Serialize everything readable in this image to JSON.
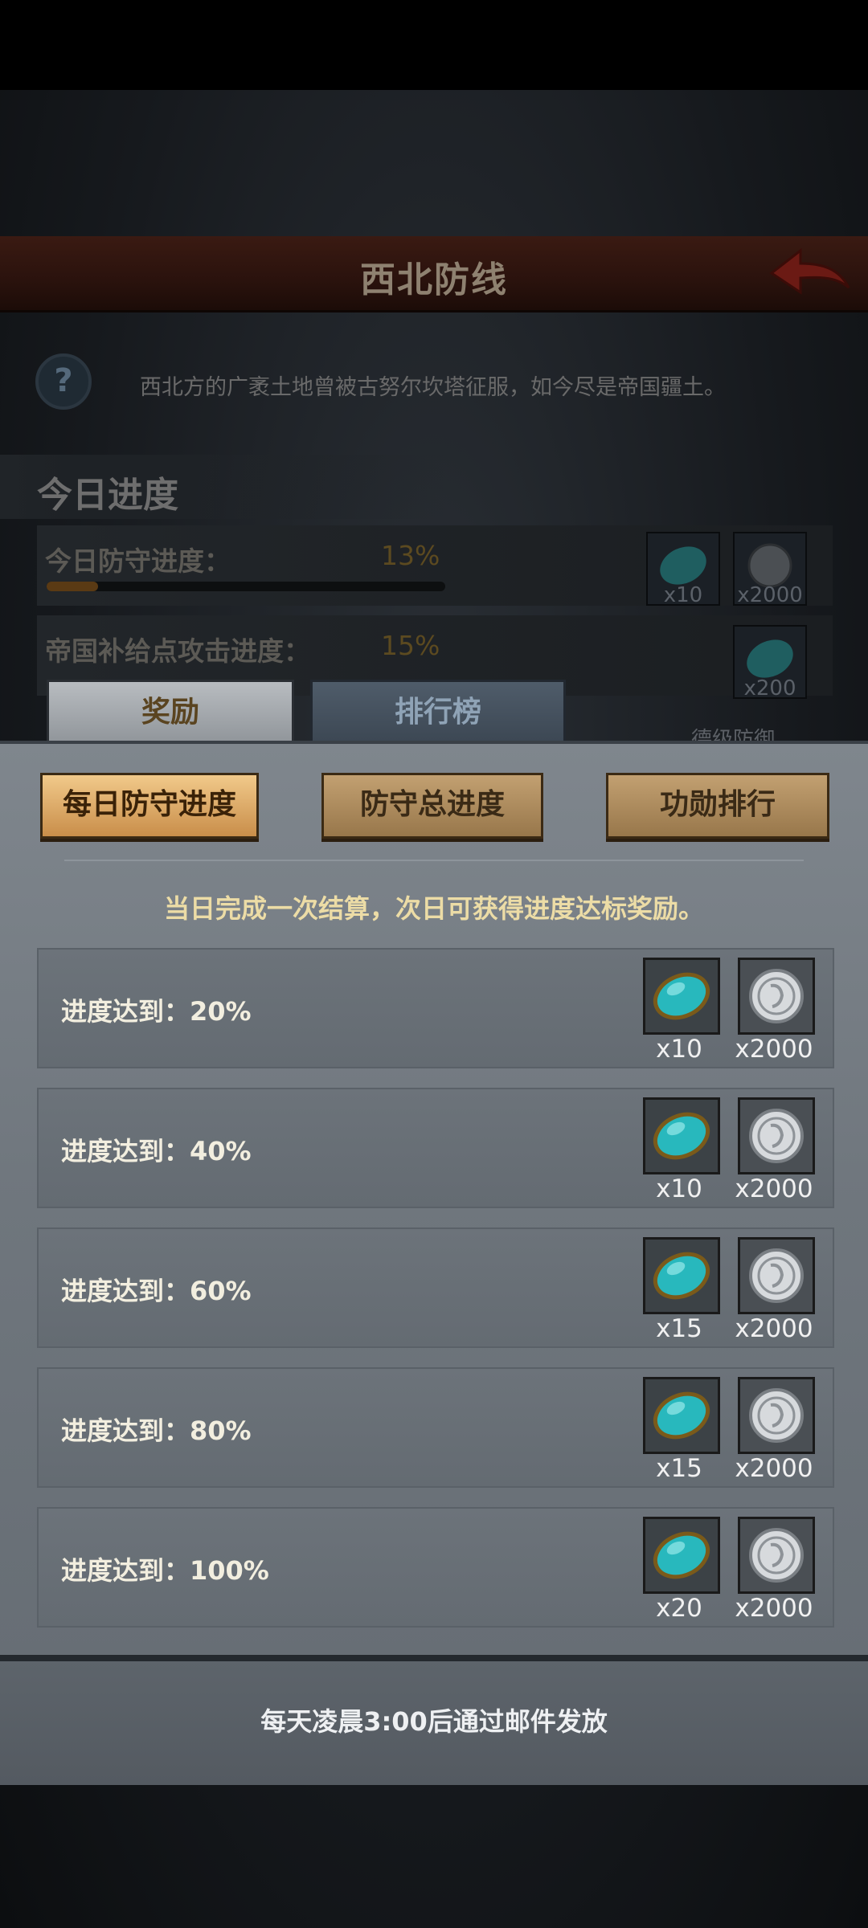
{
  "background_page": {
    "title": "西北防线",
    "description": "西北方的广袤土地曾被古努尔坎塔征服，如今尽是帝国疆土。",
    "section_title": "今日进度",
    "progress_rows": [
      {
        "label": "今日防守进度：",
        "percent_text": "13%",
        "progress": 0.13,
        "rewards": [
          {
            "icon": "gem-icon",
            "qty": "x10"
          },
          {
            "icon": "silver-coin-icon",
            "qty": "x2000"
          }
        ]
      },
      {
        "label": "帝国补给点攻击进度：",
        "percent_text": "15%",
        "progress": 0.15,
        "rewards": [
          {
            "icon": "gem-icon",
            "qty": "x200"
          }
        ]
      }
    ],
    "partial_text": "德级防御"
  },
  "tabs": [
    {
      "label": "奖励",
      "active": true
    },
    {
      "label": "排行榜",
      "active": false
    }
  ],
  "filters": [
    {
      "label": "每日防守进度",
      "active": true
    },
    {
      "label": "防守总进度",
      "active": false
    },
    {
      "label": "功勋排行",
      "active": false
    }
  ],
  "notice": "当日完成一次结算，次日可获得进度达标奖励。",
  "reward_rows": [
    {
      "label": "进度达到：20%",
      "gem_qty": "x10",
      "coin_qty": "x2000"
    },
    {
      "label": "进度达到：40%",
      "gem_qty": "x10",
      "coin_qty": "x2000"
    },
    {
      "label": "进度达到：60%",
      "gem_qty": "x15",
      "coin_qty": "x2000"
    },
    {
      "label": "进度达到：80%",
      "gem_qty": "x15",
      "coin_qty": "x2000"
    },
    {
      "label": "进度达到：100%",
      "gem_qty": "x20",
      "coin_qty": "x2000"
    }
  ],
  "footer": "每天凌晨3:00后通过邮件发放",
  "colors": {
    "gem": "#2fc4c8",
    "gold_text": "#ecdca6",
    "active_button": "#e0b070"
  }
}
